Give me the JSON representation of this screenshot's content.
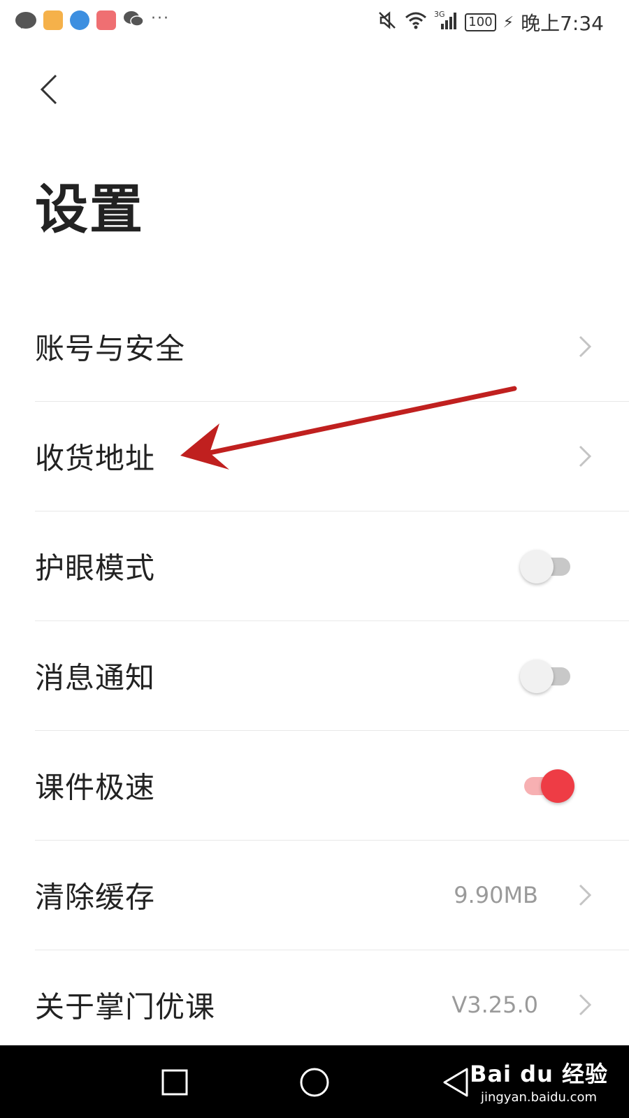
{
  "status_bar": {
    "time": "晚上7:34",
    "battery": "100",
    "network": "3G",
    "more": "···"
  },
  "header": {
    "title": "设置"
  },
  "settings": [
    {
      "label": "账号与安全",
      "type": "link"
    },
    {
      "label": "收货地址",
      "type": "link"
    },
    {
      "label": "护眼模式",
      "type": "toggle",
      "on": false
    },
    {
      "label": "消息通知",
      "type": "toggle",
      "on": false
    },
    {
      "label": "课件极速",
      "type": "toggle",
      "on": true
    },
    {
      "label": "清除缓存",
      "type": "link",
      "value": "9.90MB"
    },
    {
      "label": "关于掌门优课",
      "type": "link",
      "value": "V3.25.0"
    }
  ],
  "watermark": {
    "main": "Bai du 经验",
    "sub": "jingyan.baidu.com"
  },
  "colors": {
    "accent": "#ee3c45",
    "annotation_arrow": "#c0201f"
  }
}
